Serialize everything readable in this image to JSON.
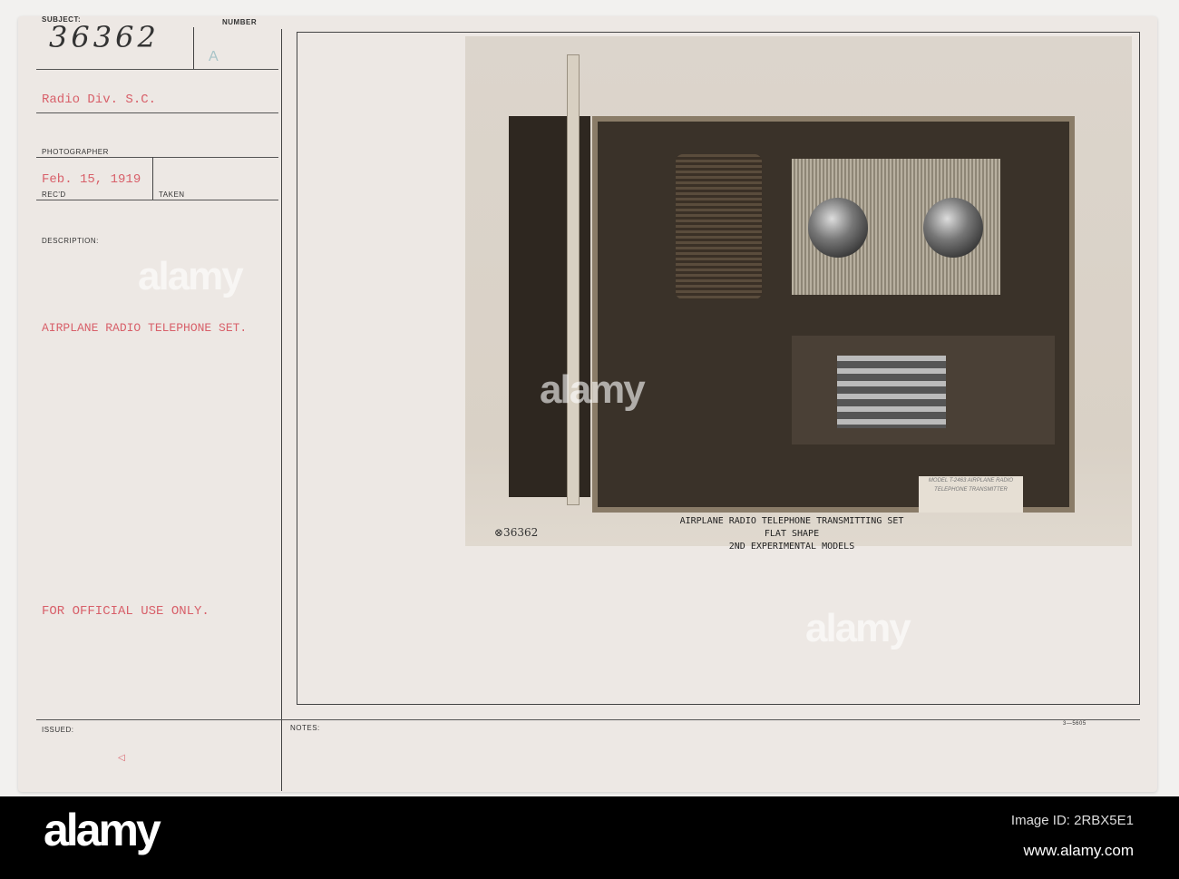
{
  "card": {
    "subject_label": "SUBJECT:",
    "subject_number": "36362",
    "number_label": "NUMBER",
    "number_value": "A",
    "division": "Radio Div. S.C.",
    "photographer_label": "PHOTOGRAPHER",
    "received_date": "Feb. 15, 1919",
    "recd_label": "REC'D",
    "taken_label": "TAKEN",
    "description_label": "DESCRIPTION:",
    "description": "AIRPLANE RADIO TELEPHONE SET.",
    "restriction": "FOR OFFICIAL USE ONLY.",
    "issued_label": "ISSUED:",
    "notes_label": "NOTES:",
    "form_number": "3—5605"
  },
  "photo": {
    "caption_lines": [
      "AIRPLANE RADIO TELEPHONE TRANSMITTING SET",
      "FLAT SHAPE",
      "2ND EXPERIMENTAL MODELS"
    ],
    "negative_number": "⊗36362",
    "tag_text": "MODEL T-2463 AIRPLANE RADIO TELEPHONE TRANSMITTER"
  },
  "footer": {
    "logo": "alamy",
    "image_id": "Image ID: 2RBX5E1",
    "url": "www.alamy.com"
  }
}
